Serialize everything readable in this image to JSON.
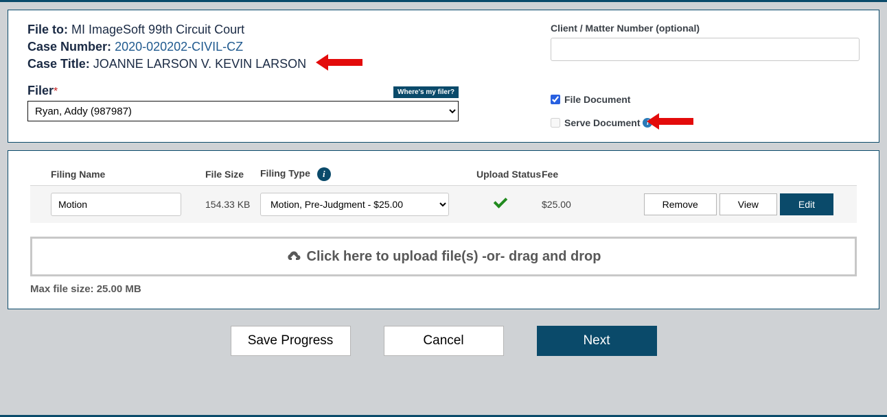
{
  "header": {
    "file_to_label": "File to:",
    "court_name": "MI ImageSoft 99th Circuit Court",
    "case_number_label": "Case Number:",
    "case_number": "2020-020202-CIVIL-CZ",
    "case_title_label": "Case Title:",
    "case_title": "JOANNE LARSON V. KEVIN LARSON"
  },
  "filer": {
    "label": "Filer",
    "wheres_filer": "Where's my filer?",
    "selected": "Ryan, Addy (987987)"
  },
  "right": {
    "client_label": "Client / Matter Number (optional)",
    "client_value": "",
    "file_document_label": "File Document",
    "file_document_checked": true,
    "serve_document_label": "Serve Document",
    "serve_document_checked": false
  },
  "table": {
    "headers": {
      "name": "Filing Name",
      "size": "File Size",
      "type": "Filing Type",
      "status": "Upload Status",
      "fee": "Fee"
    },
    "row": {
      "name": "Motion",
      "size": "154.33 KB",
      "type": "Motion, Pre-Judgment - $25.00",
      "fee": "$25.00",
      "remove": "Remove",
      "view": "View",
      "edit": "Edit"
    }
  },
  "dropzone": {
    "text": "Click here to upload file(s) -or- drag and drop"
  },
  "max_size": "Max file size: 25.00 MB",
  "buttons": {
    "save": "Save Progress",
    "cancel": "Cancel",
    "next": "Next"
  }
}
